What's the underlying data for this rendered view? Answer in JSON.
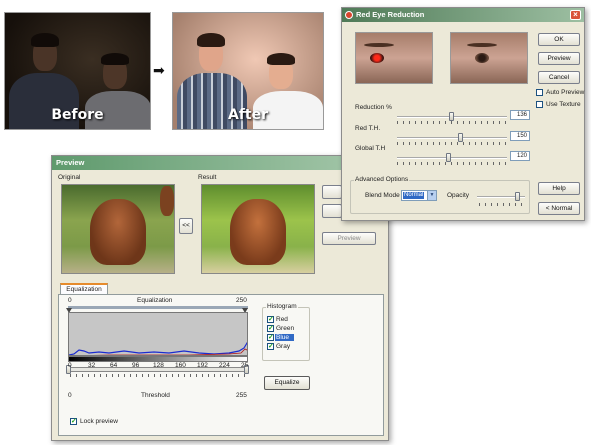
{
  "comparison": {
    "before_caption": "Before",
    "after_caption": "After",
    "arrow": "➡"
  },
  "red_eye_dialog": {
    "title": "Red Eye Reduction",
    "buttons": {
      "ok": "OK",
      "preview": "Preview",
      "cancel": "Cancel",
      "help": "Help",
      "normal": "< Normal"
    },
    "checkboxes": [
      {
        "label": "Auto Preview",
        "checked": false
      },
      {
        "label": "Use Texture",
        "checked": false
      }
    ],
    "sliders": [
      {
        "label": "Reduction %",
        "value": "136",
        "level": 0.5
      },
      {
        "label": "Red T.H.",
        "value": "150",
        "level": 0.58
      },
      {
        "label": "Global T.H",
        "value": "120",
        "level": 0.47
      }
    ],
    "advanced": {
      "group_label": "Advanced Options",
      "blend_mode_label": "Blend Mode",
      "blend_mode_value": "Normal",
      "opacity_label": "Opacity",
      "opacity_level": 0.85
    }
  },
  "preview_window": {
    "title": "Preview",
    "original_label": "Original",
    "result_label": "Result",
    "swap_button": "<<",
    "preview_button": "Preview",
    "tab_label": "Equalization",
    "eq_label": "Equalization",
    "eq_min": "0",
    "eq_max": "250",
    "scale_ticks": [
      "0",
      "32",
      "64",
      "96",
      "128",
      "160",
      "192",
      "224",
      "25"
    ],
    "threshold_label": "Threshold",
    "threshold_min": "0",
    "threshold_max": "255",
    "histogram": {
      "group_label": "Histogram",
      "channels": [
        {
          "label": "Red",
          "checked": true
        },
        {
          "label": "Green",
          "checked": true
        },
        {
          "label": "Blue",
          "checked": true,
          "selected": true
        },
        {
          "label": "Gray",
          "checked": true
        }
      ]
    },
    "equalize_button": "Equalize",
    "lock_preview_label": "Lock preview",
    "lock_preview_checked": true
  },
  "colors": {
    "xp_title_blue": "#0a5ed6",
    "red_eye_title": "#5c7f5e",
    "preview_title": "#6e9c78"
  }
}
